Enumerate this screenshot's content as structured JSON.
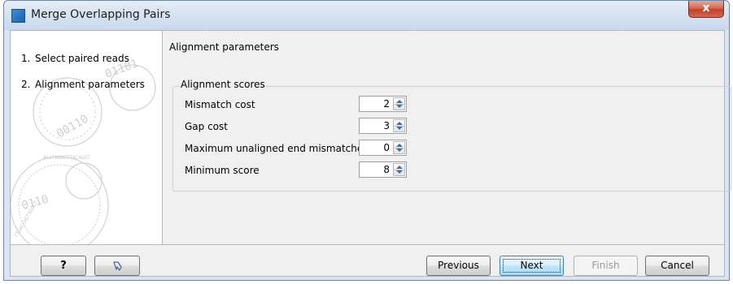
{
  "window": {
    "title": "Merge Overlapping Pairs",
    "close_label": "x",
    "app_icon": "clc-app-icon"
  },
  "steps": [
    {
      "number": "1.",
      "label": "Select paired reads"
    },
    {
      "number": "2.",
      "label": "Alignment parameters"
    }
  ],
  "content": {
    "heading": "Alignment parameters",
    "group_title": "Alignment scores",
    "fields": [
      {
        "label": "Mismatch cost",
        "value": "2"
      },
      {
        "label": "Gap cost",
        "value": "3"
      },
      {
        "label": "Maximum unaligned end mismatches",
        "value": "0"
      },
      {
        "label": "Minimum score",
        "value": "8"
      }
    ]
  },
  "buttons": {
    "help": "?",
    "reset_icon": "reset-icon",
    "previous": "Previous",
    "next": "Next",
    "finish": "Finish",
    "cancel": "Cancel"
  },
  "colors": {
    "titlebar": "#d5e2f1",
    "close": "#c1412a",
    "client_bg": "#f0f0f0",
    "next_button": "#bee6fd"
  }
}
